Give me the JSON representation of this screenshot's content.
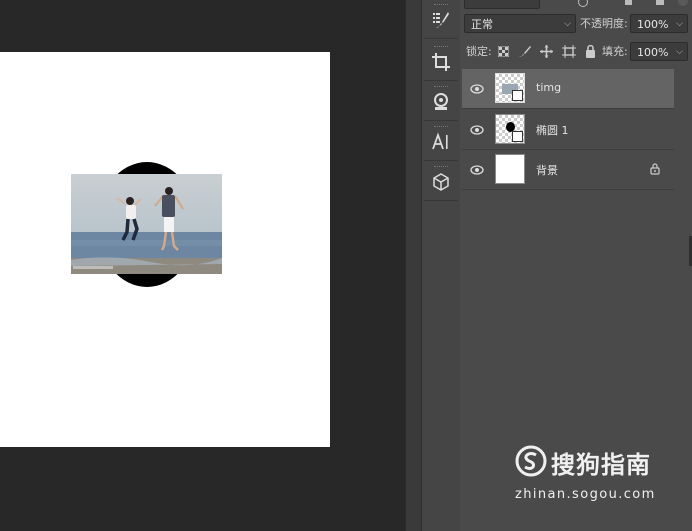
{
  "panel": {
    "blend_mode": "正常",
    "opacity_label": "不透明度:",
    "opacity_value": "100%",
    "lock_label": "锁定:",
    "fill_label": "填充:",
    "fill_value": "100%"
  },
  "layers": [
    {
      "name": "timg",
      "selected": true
    },
    {
      "name": "椭圆 1",
      "selected": false
    },
    {
      "name": "背景",
      "selected": false,
      "locked": true
    }
  ],
  "tools": [
    "brush-settings-icon",
    "crop-icon",
    "stamp-icon",
    "character-icon",
    "3d-cube-icon"
  ],
  "watermark": {
    "brand": "搜狗指南",
    "url": "zhinan.sogou.com"
  },
  "colors": {
    "workspace": "#282828",
    "panel": "#4a4a4a",
    "selected_layer": "#646464"
  }
}
